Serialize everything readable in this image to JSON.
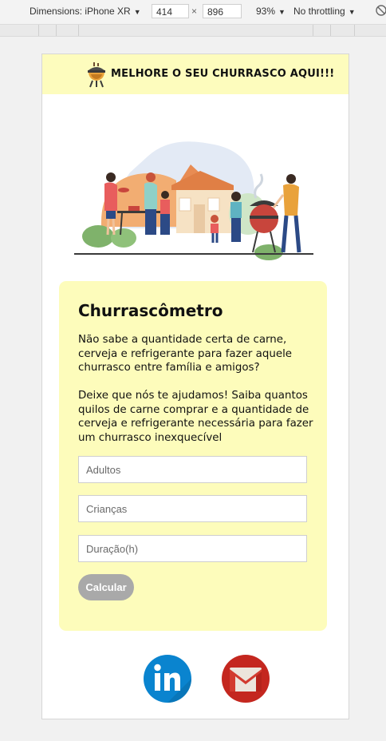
{
  "devtools": {
    "dimensions_label": "Dimensions: iPhone XR",
    "width": "414",
    "times": "×",
    "height": "896",
    "zoom": "93%",
    "throttling": "No throttling"
  },
  "header": {
    "title": "MELHORE O SEU CHURRASCO AQUI!!!"
  },
  "card": {
    "title": "Churrascômetro",
    "intro": "Não sabe a quantidade certa de carne, cerveja e refrigerante para fazer aquele churrasco entre família e amigos?",
    "description": "Deixe que nós te ajudamos! Saiba quantos quilos de carne comprar e a quantidade de cerveja e refrigerante necessária para fazer um churrasco inexquecível"
  },
  "form": {
    "adults_placeholder": "Adultos",
    "children_placeholder": "Crianças",
    "duration_placeholder": "Duração(h)",
    "submit_label": "Calcular"
  },
  "colors": {
    "header_bg": "#fdfcbd",
    "card_bg": "#fdfcbb",
    "button_bg": "#a9a9a9",
    "linkedin_blue": "#0a84cf",
    "gmail_red": "#c4271f"
  },
  "icons": {
    "header_logo": "grill-icon",
    "social": [
      "linkedin-icon",
      "gmail-icon"
    ]
  }
}
